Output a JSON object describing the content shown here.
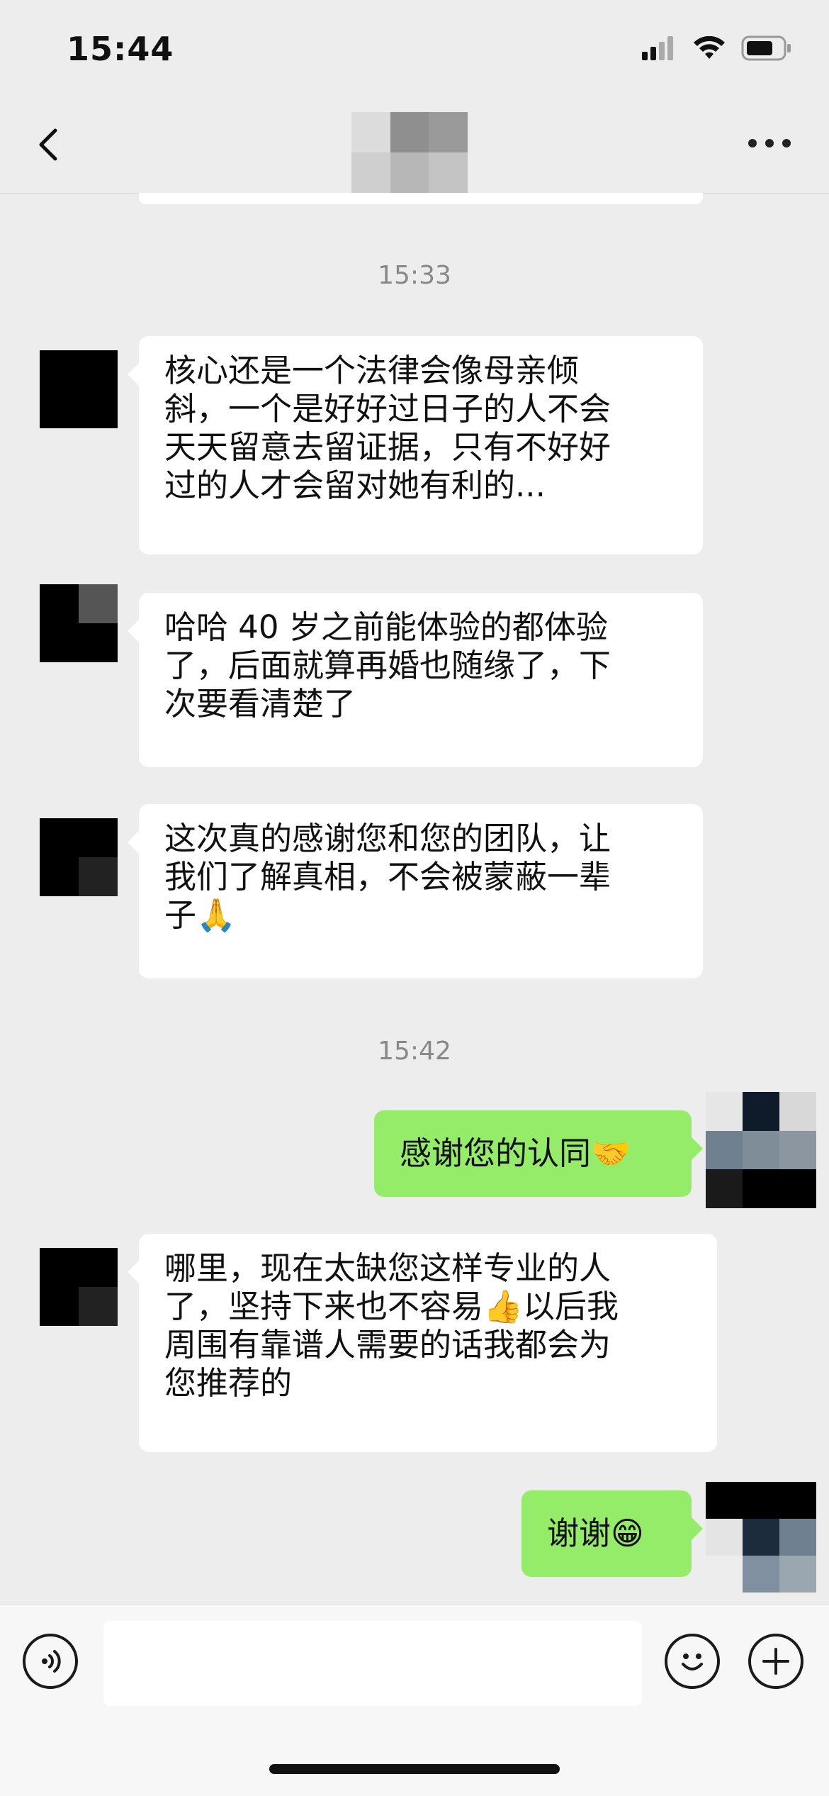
{
  "status_bar": {
    "time": "15:44"
  },
  "timestamps": [
    "15:33",
    "15:42"
  ],
  "messages": [
    {
      "side": "left",
      "text": "核心还是一个法律会像母亲倾\n斜，一个是好好过日子的人不会\n天天留意去留证据，只有不好好\n过的人才会留对她有利的..."
    },
    {
      "side": "left",
      "text": "哈哈 40 岁之前能体验的都体验\n了，后面就算再婚也随缘了，下\n次要看清楚了"
    },
    {
      "side": "left",
      "text": "这次真的感谢您和您的团队，让\n我们了解真相，不会被蒙蔽一辈\n子🙏"
    },
    {
      "side": "right",
      "text": "感谢您的认同🤝"
    },
    {
      "side": "left",
      "text": "哪里，现在太缺您这样专业的人\n了，坚持下来也不容易👍以后我\n周围有靠谱人需要的话我都会为\n您推荐的"
    },
    {
      "side": "right",
      "text": "谢谢😁"
    }
  ],
  "icons": {
    "back": "chevron-left-icon",
    "more": "more-dots-icon",
    "voice": "voice-icon",
    "emoji": "emoji-icon",
    "add": "plus-icon"
  },
  "colors": {
    "background": "#ededed",
    "incoming_bubble": "#ffffff",
    "outgoing_bubble": "#95ec69"
  }
}
